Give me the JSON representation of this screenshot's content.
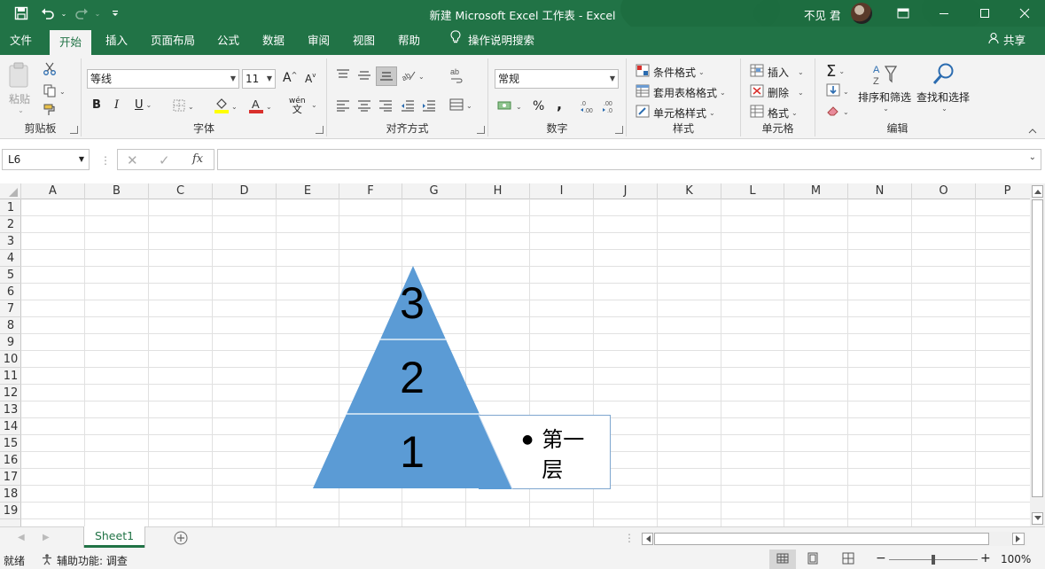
{
  "titlebar": {
    "title": "新建 Microsoft Excel 工作表  -  Excel",
    "user": "不见 君",
    "colors": {
      "accent": "#217346"
    }
  },
  "tabs": [
    "文件",
    "开始",
    "插入",
    "页面布局",
    "公式",
    "数据",
    "审阅",
    "视图",
    "帮助",
    "操作说明搜索"
  ],
  "share_label": "共享",
  "ribbon": {
    "clipboard": {
      "paste": "粘贴",
      "label": "剪贴板"
    },
    "font": {
      "name": "等线",
      "size": "11",
      "label": "字体",
      "bold": "B",
      "italic": "I",
      "underline": "U",
      "grow": "A",
      "shrink": "A",
      "wen": "wén"
    },
    "alignment": {
      "label": "对齐方式"
    },
    "number": {
      "format": "常规",
      "label": "数字",
      "percent": "%",
      "comma": ","
    },
    "styles": {
      "conditional": "条件格式",
      "table": "套用表格格式",
      "cell": "单元格样式",
      "label": "样式"
    },
    "cells": {
      "insert": "插入",
      "delete": "删除",
      "format": "格式",
      "label": "单元格"
    },
    "editing": {
      "sort": "排序和筛选",
      "find": "查找和选择",
      "label": "编辑"
    }
  },
  "formula_bar": {
    "name_box": "L6",
    "fx": "fx",
    "value": ""
  },
  "columns": [
    "A",
    "B",
    "C",
    "D",
    "E",
    "F",
    "G",
    "H",
    "I",
    "J",
    "K",
    "L",
    "M",
    "N",
    "O",
    "P"
  ],
  "rows": [
    "1",
    "2",
    "3",
    "4",
    "5",
    "6",
    "7",
    "8",
    "9",
    "10",
    "11",
    "12",
    "13",
    "14",
    "15",
    "16",
    "17",
    "18",
    "19"
  ],
  "smartart": {
    "levels": [
      "3",
      "2",
      "1"
    ],
    "text_pane_bullet": "第一层",
    "fill_color": "#5b9bd5"
  },
  "sheets": [
    "Sheet1"
  ],
  "status": {
    "ready": "就绪",
    "accessibility": "辅助功能: 调查",
    "zoom": "100%"
  }
}
